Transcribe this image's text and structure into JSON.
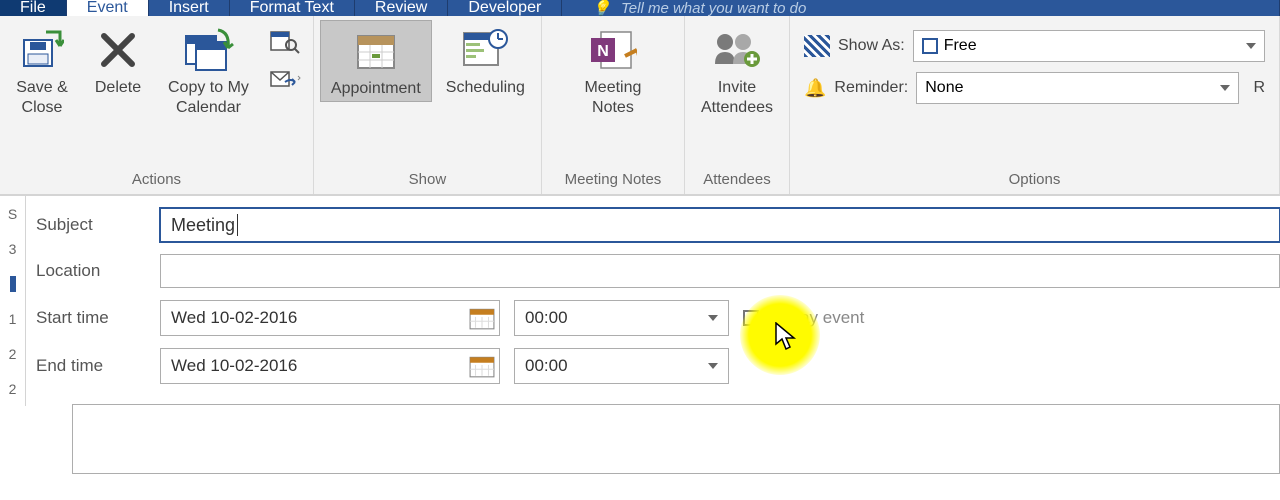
{
  "tabs": {
    "file": "File",
    "event": "Event",
    "insert": "Insert",
    "formatText": "Format Text",
    "review": "Review",
    "developer": "Developer",
    "prompt": "Tell me what you want to do"
  },
  "ribbon": {
    "actions": {
      "saveClose1": "Save &",
      "saveClose2": "Close",
      "delete": "Delete",
      "copy1": "Copy to My",
      "copy2": "Calendar",
      "label": "Actions"
    },
    "show": {
      "appointment": "Appointment",
      "scheduling": "Scheduling",
      "label": "Show"
    },
    "notes": {
      "meeting1": "Meeting",
      "meeting2": "Notes",
      "label": "Meeting Notes"
    },
    "attendees": {
      "invite1": "Invite",
      "invite2": "Attendees",
      "label": "Attendees"
    },
    "options": {
      "showAs": "Show As:",
      "showAsValue": "Free",
      "reminder": "Reminder:",
      "reminderValue": "None",
      "label": "Options"
    }
  },
  "form": {
    "subjectLabel": "Subject",
    "subjectValue": "Meeting ",
    "locationLabel": "Location",
    "locationValue": "",
    "startLabel": "Start time",
    "startDate": "Wed 10-02-2016",
    "startTime": "00:00",
    "endLabel": "End time",
    "endDate": "Wed 10-02-2016",
    "endTime": "00:00",
    "allDay": "All day event"
  },
  "edge": {
    "a": "S",
    "b": "3",
    "c": "1",
    "d": "2",
    "e": "2"
  }
}
